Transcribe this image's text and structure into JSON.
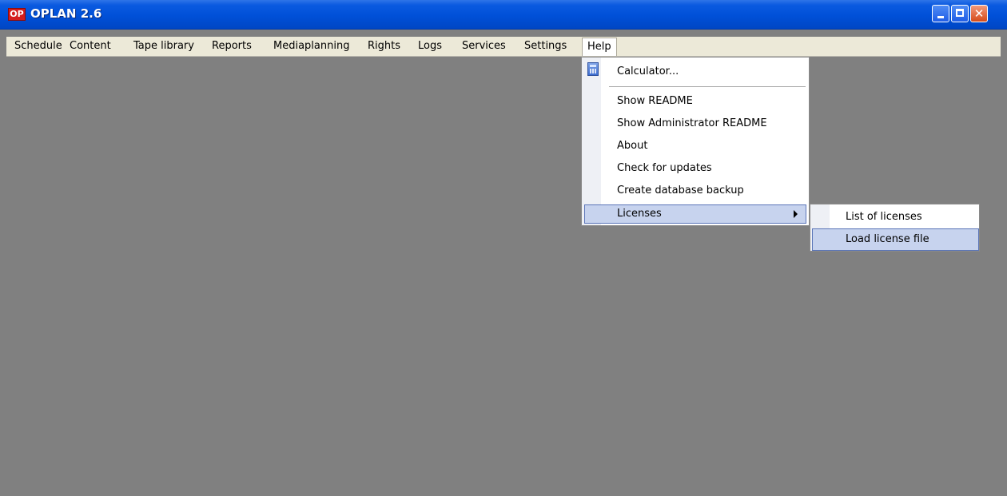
{
  "window": {
    "title": "OPLAN 2.6",
    "logo_text": "OP",
    "close_glyph": "✕"
  },
  "menubar": {
    "items": [
      "Schedule",
      "Content",
      "Tape library",
      "Reports",
      "Mediaplanning",
      "Rights",
      "Logs",
      "Services",
      "Settings",
      "Help"
    ]
  },
  "help_menu": {
    "calculator": "Calculator...",
    "show_readme": "Show README",
    "show_admin_readme": "Show Administrator README",
    "about": "About",
    "check_updates": "Check for updates",
    "create_backup": "Create database backup",
    "licenses": "Licenses"
  },
  "licenses_submenu": {
    "list": "List of licenses",
    "load": "Load license file"
  },
  "icons": {
    "calculator": "calculator-icon",
    "submenu_arrow": "chevron-right-icon"
  },
  "colors": {
    "titlebar": "#0050d8",
    "workspace": "#808080",
    "menubar": "#ece9d8",
    "highlight": "#c7d3ee"
  }
}
